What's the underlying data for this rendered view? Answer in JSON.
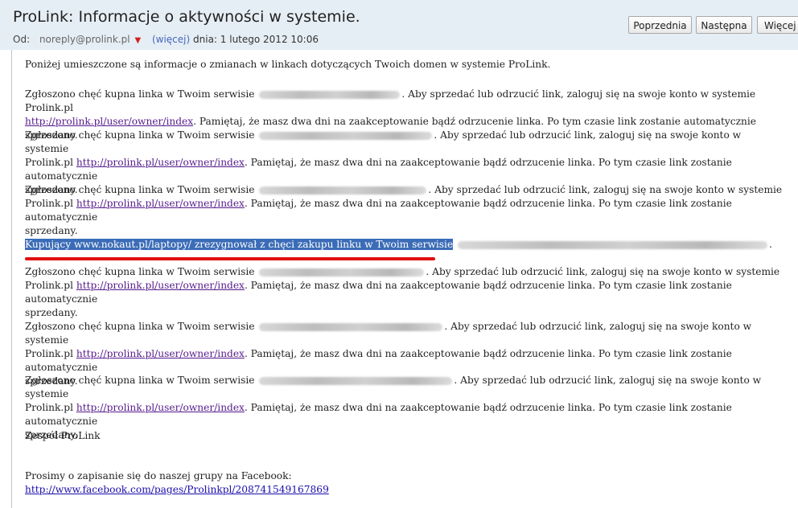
{
  "header": {
    "subject": "ProLink: Informacje o aktywności w systemie.",
    "from_label": "Od:",
    "from_email": "noreply@prolink.pl",
    "more_link": "(więcej)",
    "date_text": "dnia: 1 lutego 2012 10:06",
    "btn_prev": "Poprzednia",
    "btn_next": "Następna",
    "btn_more": "Więcej"
  },
  "body": {
    "intro": "Poniżej umieszczone są informacje o zmianach w linkach dotyczących Twoich domen w systemie ProLink.",
    "msg_prefix": "Zgłoszono chęć kupna linka w Twoim serwisie",
    "msg_mid": ". Aby sprzedać lub odrzucić link, zaloguj się na swoje konto w systemie Prolink.pl",
    "msg_mid_b": ". Aby sprzedać lub odrzucić link, zaloguj się na swoje konto w systemie",
    "msg_prolink": "Prolink.pl",
    "link": "http://prolink.pl/user/owner/index",
    "msg_suffix": ". Pamiętaj, że masz dwa dni na zaakceptowanie bądź odrzucenie linka. Po tym czasie link zostanie automatycznie sprzedany.",
    "msg_suffix_a": ". Pamiętaj, że masz dwa dni na zaakceptowanie bądź odrzucenie linka. Po tym czasie link zostanie automatycznie",
    "msg_suffix_b": "sprzedany.",
    "cancel_text": "Kupujący www.nokaut.pl/laptopy/ zrezygnował z chęci zakupu linku w Twoim serwisie",
    "team": "Zespół ProLink",
    "fb_text": "Prosimy o zapisanie się do naszej grupy na Facebook:",
    "fb_link": "http://www.facebook.com/pages/Prolinkpl/208741549167869"
  }
}
